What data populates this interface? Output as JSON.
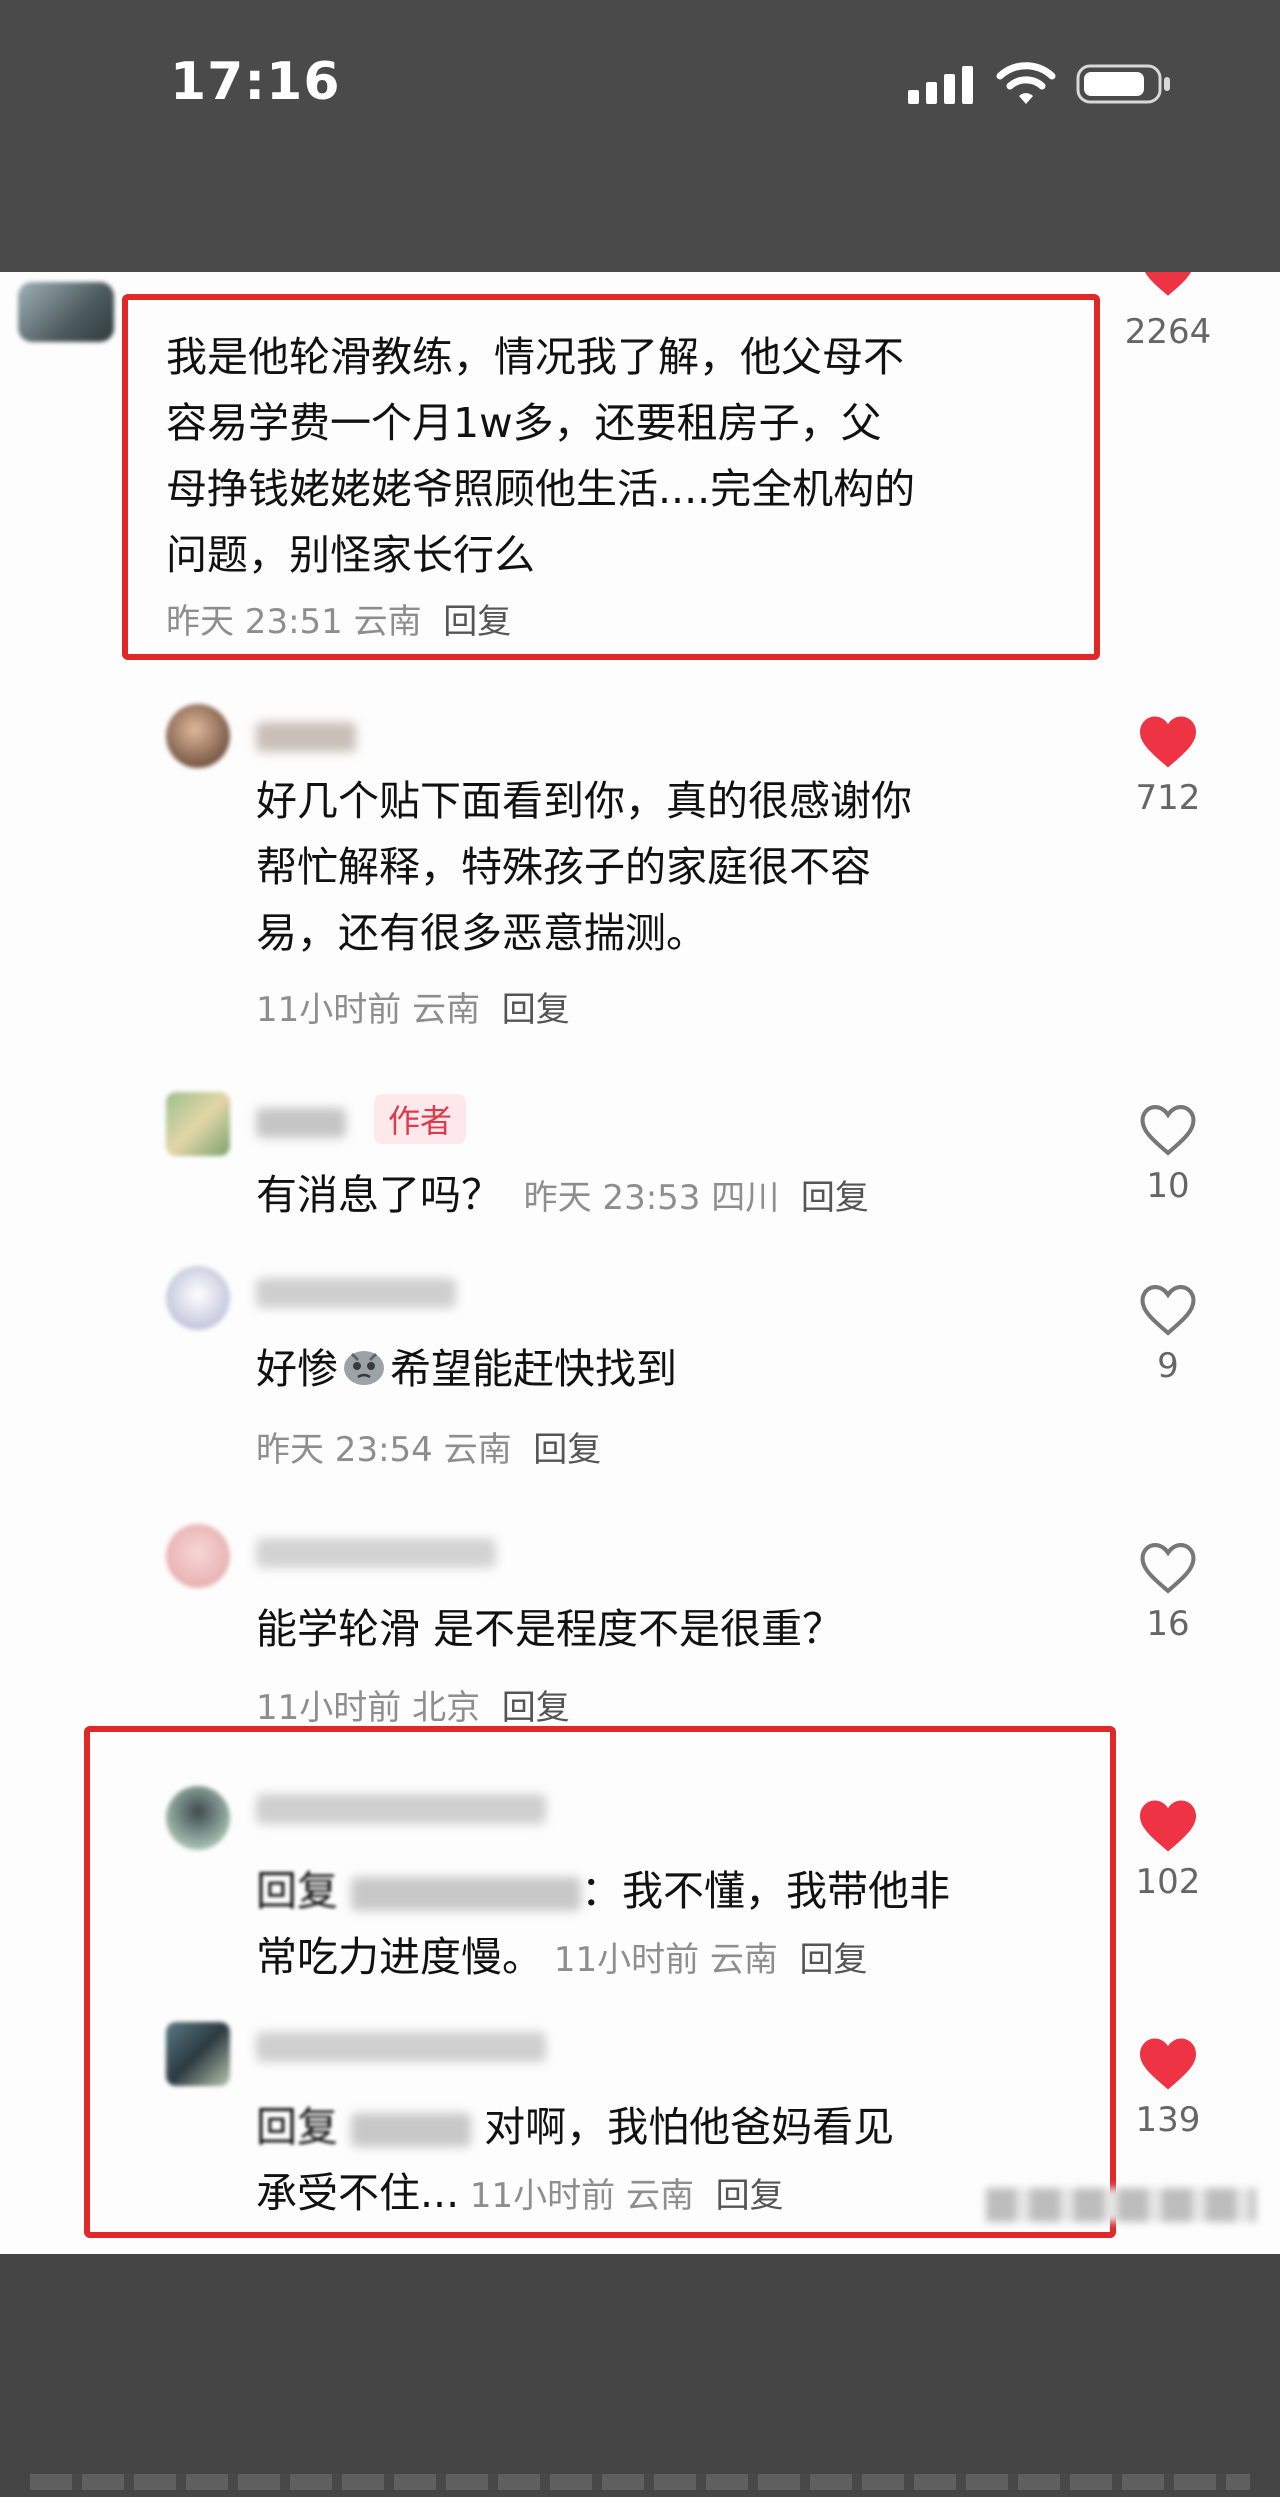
{
  "status_bar": {
    "time": "17:16",
    "icons": [
      "cellular-signal-icon",
      "wifi-icon",
      "battery-icon"
    ]
  },
  "colors": {
    "highlight_border": "#e02828",
    "like_active": "#ee3345",
    "author_badge": "#e0394a"
  },
  "comments": [
    {
      "id": "c1",
      "text": "我是他轮滑教练，情况我了解，他父母不容易学费一个月1w多，还要租房子，父母挣钱姥姥姥爷照顾他生活....完全机构的问题，别怪家长行么",
      "lines": [
        "我是他轮滑教练，情况我了解，他父母不",
        "容易学费一个月1w多，还要租房子，父",
        "母挣钱姥姥姥爷照顾他生活....完全机构的",
        "问题，别怪家长行么"
      ],
      "time": "昨天 23:51",
      "location": "云南",
      "reply_label": "回复",
      "likes": "2264",
      "liked": true
    },
    {
      "id": "c2",
      "text": "好几个贴下面看到你，真的很感谢你帮忙解释，特殊孩子的家庭很不容易，还有很多恶意揣测。",
      "lines": [
        "好几个贴下面看到你，真的很感谢你",
        "帮忙解释，特殊孩子的家庭很不容",
        "易，还有很多恶意揣测。"
      ],
      "time": "11小时前",
      "location": "云南",
      "reply_label": "回复",
      "likes": "712",
      "liked": true
    },
    {
      "id": "c3",
      "badge": "作者",
      "text": "有消息了吗？",
      "time": "昨天 23:53",
      "location": "四川",
      "reply_label": "回复",
      "likes": "10",
      "liked": false
    },
    {
      "id": "c4",
      "text_before": "好惨",
      "text_after": "希望能赶快找到",
      "time": "昨天 23:54",
      "location": "云南",
      "reply_label": "回复",
      "likes": "9",
      "liked": false
    },
    {
      "id": "c5",
      "text": "能学轮滑 是不是程度不是很重？",
      "time": "11小时前",
      "location": "北京",
      "reply_label": "回复",
      "likes": "16",
      "liked": false
    },
    {
      "id": "c6",
      "reply_prefix": "回复",
      "line1_after": "：我不懂，我带他非",
      "line2": "常吃力进度慢。",
      "time": "11小时前",
      "location": "云南",
      "reply_label": "回复",
      "likes": "102",
      "liked": true
    },
    {
      "id": "c7",
      "reply_prefix": "回复",
      "line1_after": "对啊，我怕他爸妈看见",
      "line2": "承受不住...",
      "time": "11小时前",
      "location": "云南",
      "reply_label": "回复",
      "likes": "139",
      "liked": true
    }
  ]
}
